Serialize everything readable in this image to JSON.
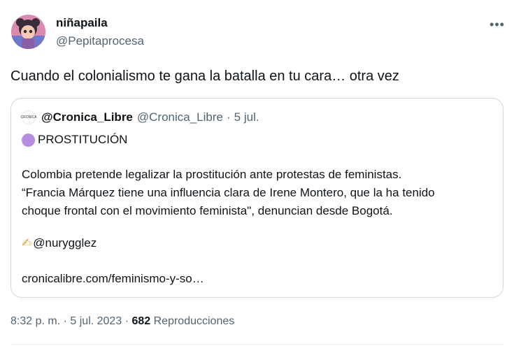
{
  "author": {
    "name": "niñapaila",
    "handle": "@Pepitaprocesa"
  },
  "more_icon": "more-horizontal-icon",
  "tweet": {
    "text": "Cuando el colonialismo te gana la batalla en tu cara… otra vez"
  },
  "quote": {
    "name": "@Cronica_Libre",
    "handle": "@Cronica_Libre",
    "separator": "·",
    "time": "5 jul.",
    "logo_text": "CRONICA",
    "tag": "PROSTITUCIÓN",
    "body_lines": [
      "Colombia pretende legalizar la prostitución ante protestas de feministas.",
      "“Francia Márquez tiene una influencia clara de Irene Montero, que la ha tenido",
      "choque frontal con el movimiento feminista\", denuncian desde Bogotá."
    ],
    "author_mention": "@nurygglez",
    "pen_emoji": "✍",
    "link": "cronicalibre.com/feminismo-y-so…"
  },
  "footer": {
    "time": "8:32 p. m.",
    "sep1": "·",
    "date": "5 jul. 2023",
    "sep2": "·",
    "views_count": "682",
    "views_label": "Reproducciones"
  },
  "colors": {
    "text": "#0f1419",
    "secondary": "#536471",
    "border": "#cfd9de",
    "purple_circle": "#b68ce0"
  }
}
